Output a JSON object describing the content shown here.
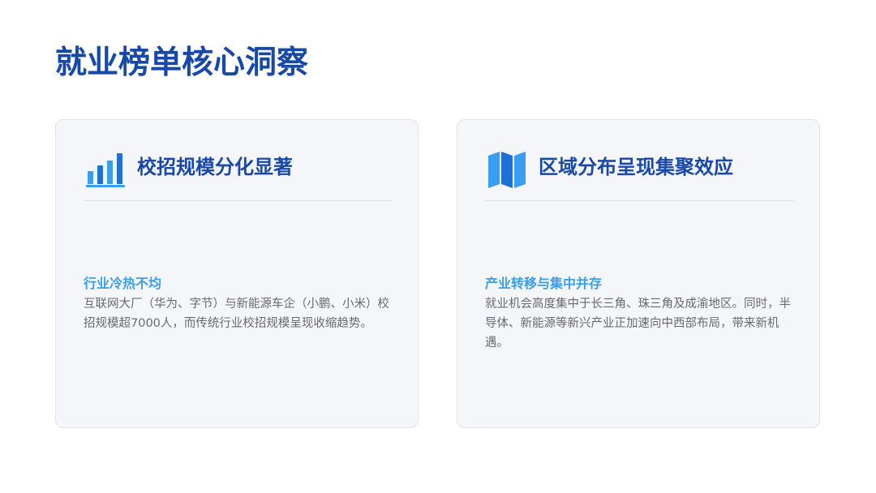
{
  "page": {
    "title": "就业榜单核心洞察"
  },
  "colors": {
    "title": "#1848a8",
    "accent": "#3a9ef0",
    "body_text": "#666a70",
    "card_bg": "#f4f6fa",
    "card_border": "#dfe3ea"
  },
  "cards": [
    {
      "icon": "bar-chart-icon",
      "title": "校招规模分化显著",
      "subtitle": "行业冷热不均",
      "body": "互联网大厂（华为、字节）与新能源车企（小鹏、小米）校招规模超7000人，而传统行业校招规模呈现收缩趋势。"
    },
    {
      "icon": "map-icon",
      "title": "区域分布呈现集聚效应",
      "subtitle": "产业转移与集中并存",
      "body": "就业机会高度集中于长三角、珠三角及成渝地区。同时，半导体、新能源等新兴产业正加速向中西部布局，带来新机遇。"
    }
  ]
}
